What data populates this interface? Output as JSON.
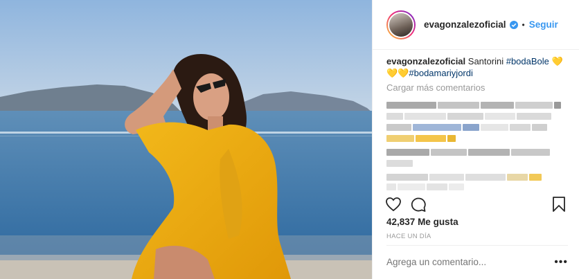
{
  "post": {
    "username": "evagonzalezoficial",
    "verified": true,
    "follow_label": "Seguir",
    "separator": "•",
    "caption": {
      "username": "evagonzalezoficial",
      "text": "Santorini",
      "hashtags": [
        "#bodaBole",
        "#bodamariyjordi"
      ],
      "emoji_line1": "💛",
      "emoji_line2": "💛💛"
    },
    "load_more_label": "Cargar más comentarios",
    "likes_count": "42,837",
    "likes_label": "Me gusta",
    "time_ago": "HACE UN DÍA",
    "comment_placeholder": "Agrega un comentario...",
    "more_options": "•••"
  },
  "icons": {
    "like": "heart-icon",
    "comment": "comment-bubble-icon",
    "save": "bookmark-icon",
    "verified": "verified-badge-icon",
    "more": "more-options-icon"
  },
  "colors": {
    "accent": "#3897f0",
    "hashtag": "#003569",
    "muted": "#999999",
    "text": "#262626"
  }
}
